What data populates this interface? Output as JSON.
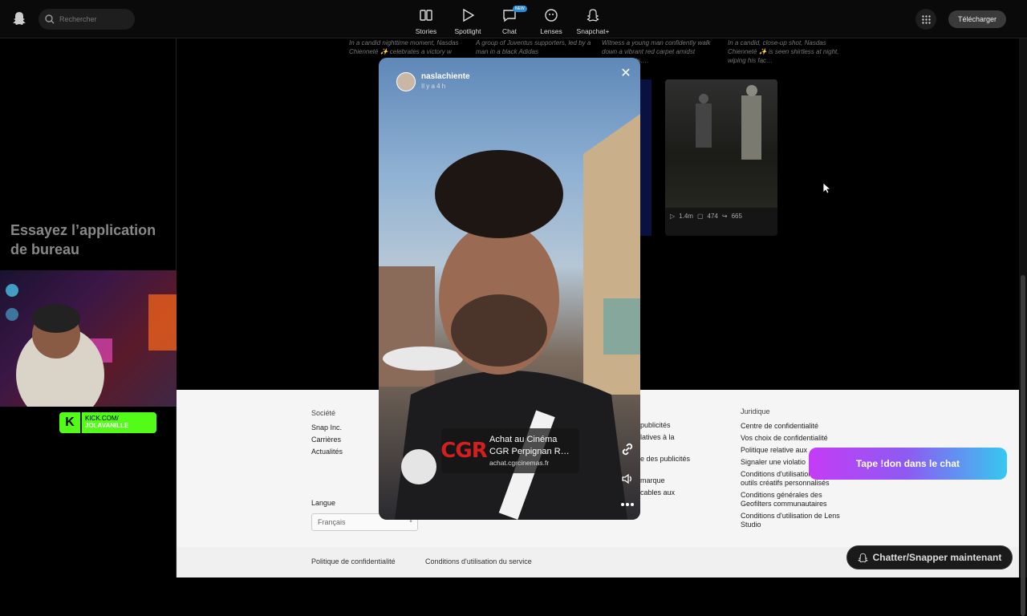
{
  "topbar": {
    "search_placeholder": "Rechercher",
    "nav": [
      {
        "label": "Stories",
        "icon": "stories-icon"
      },
      {
        "label": "Spotlight",
        "icon": "play-icon"
      },
      {
        "label": "Chat",
        "icon": "chat-icon",
        "badge": "NEW"
      },
      {
        "label": "Lenses",
        "icon": "lenses-icon"
      },
      {
        "label": "Snapchat+",
        "icon": "snapchat-plus-icon"
      }
    ],
    "download_label": "Télécharger"
  },
  "left_panel": {
    "promo_title": "Essayez l’application de bureau",
    "kick_url": "KICK.COM/",
    "kick_channel": "JOLAVANILLE"
  },
  "captions": [
    "In a candid nighttime moment, Nasdas Chienneté ✨ celebrates a victory w",
    "A group of Juventus supporters, led by a man in a black Adidas",
    "Witness a young man confidently walk down a vibrant red carpet amidst flashing lights.…",
    "In a candid, close-up shot, Nasdas Chienneté ✨ is seen shirtless at night, wiping his fac…"
  ],
  "card": {
    "views": "1.4m",
    "comments": "474",
    "shares": "665"
  },
  "viewer": {
    "username": "naslachiente",
    "time_ago": "Il y a 4 h",
    "ad_title": "Achat au Cinéma CGR Perpignan R…",
    "ad_url": "achat.cgrcinemas.fr",
    "ad_logo": "CGR"
  },
  "footer": {
    "societe_head": "Société",
    "societe": [
      "Snap Inc.",
      "Carrières",
      "Actualités"
    ],
    "mid_items": [
      "publicités",
      "latives à la",
      "e des publicités",
      "marque",
      "cables aux"
    ],
    "juridique_head": "Juridique",
    "juridique": [
      "Centre de confidentialité",
      "Vos choix de confidentialité",
      "Politique relative aux",
      "Signaler une violatio",
      "Conditions d'utilisation des outils créatifs personnalisés",
      "Conditions générales des Geofilters communautaires",
      "Conditions d'utilisation de Lens Studio"
    ],
    "lang_label": "Langue",
    "lang_value": "Français",
    "bottom": [
      "Politique de confidentialité",
      "Conditions d'utilisation du service"
    ]
  },
  "overlay": {
    "don_label": "Tape !don dans le chat",
    "chat_label": "Chatter/Snapper maintenant"
  }
}
